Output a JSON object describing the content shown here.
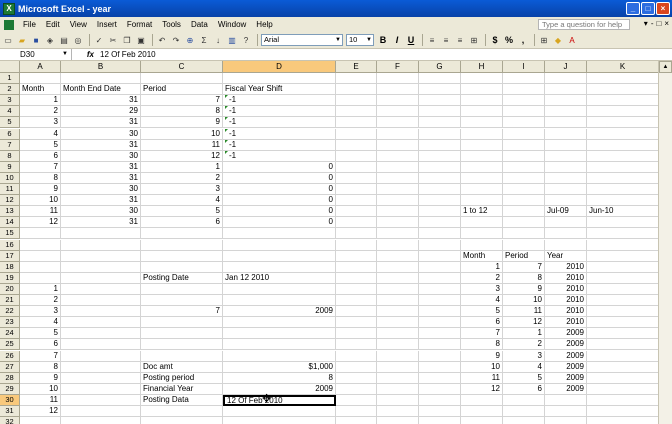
{
  "window": {
    "title": "Microsoft Excel - year",
    "minimize": "_",
    "maximize": "□",
    "close": "×"
  },
  "menu": {
    "items": [
      "File",
      "Edit",
      "View",
      "Insert",
      "Format",
      "Tools",
      "Data",
      "Window",
      "Help"
    ],
    "help_placeholder": "Type a question for help",
    "mdi_controls": [
      "▾",
      "-",
      "□",
      "×"
    ]
  },
  "toolbar": {
    "font_name": "Arial",
    "font_size": "10",
    "bold": "B",
    "italic": "I",
    "underline": "U",
    "currency": "$",
    "percent": "%",
    "comma": ","
  },
  "formula_bar": {
    "name_box": "D30",
    "fx": "fx",
    "formula": "12 Of Feb 2010"
  },
  "columns": [
    "A",
    "B",
    "C",
    "D",
    "E",
    "F",
    "G",
    "H",
    "I",
    "J",
    "K"
  ],
  "active_column": "D",
  "active_row": "30",
  "rows": [
    {
      "n": "1",
      "cells": {}
    },
    {
      "n": "2",
      "cells": {
        "A": "Month",
        "B": "Month End Date",
        "C": "Period",
        "D": "Fiscal Year Shift"
      }
    },
    {
      "n": "3",
      "cells": {
        "A": "1",
        "B": "31",
        "C": "7",
        "D": "-1"
      }
    },
    {
      "n": "4",
      "cells": {
        "A": "2",
        "B": "29",
        "C": "8",
        "D": "-1"
      }
    },
    {
      "n": "5",
      "cells": {
        "A": "3",
        "B": "31",
        "C": "9",
        "D": "-1"
      }
    },
    {
      "n": "6",
      "cells": {
        "A": "4",
        "B": "30",
        "C": "10",
        "D": "-1"
      }
    },
    {
      "n": "7",
      "cells": {
        "A": "5",
        "B": "31",
        "C": "11",
        "D": "-1"
      }
    },
    {
      "n": "8",
      "cells": {
        "A": "6",
        "B": "30",
        "C": "12",
        "D": "-1"
      }
    },
    {
      "n": "9",
      "cells": {
        "A": "7",
        "B": "31",
        "C": "1",
        "D": "0"
      }
    },
    {
      "n": "10",
      "cells": {
        "A": "8",
        "B": "31",
        "C": "2",
        "D": "0"
      }
    },
    {
      "n": "11",
      "cells": {
        "A": "9",
        "B": "30",
        "C": "3",
        "D": "0"
      }
    },
    {
      "n": "12",
      "cells": {
        "A": "10",
        "B": "31",
        "C": "4",
        "D": "0"
      }
    },
    {
      "n": "13",
      "cells": {
        "A": "11",
        "B": "30",
        "C": "5",
        "D": "0",
        "H": "1 to 12",
        "J": "Jul-09",
        "K": "Jun-10"
      }
    },
    {
      "n": "14",
      "cells": {
        "A": "12",
        "B": "31",
        "C": "6",
        "D": "0"
      }
    },
    {
      "n": "15",
      "cells": {}
    },
    {
      "n": "16",
      "cells": {}
    },
    {
      "n": "17",
      "cells": {
        "H": "Month",
        "I": "Period",
        "J": "Year"
      }
    },
    {
      "n": "18",
      "cells": {
        "H": "1",
        "I": "7",
        "J": "2010"
      }
    },
    {
      "n": "19",
      "cells": {
        "C": "Posting Date",
        "D": "Jan 12 2010",
        "H": "2",
        "I": "8",
        "J": "2010"
      }
    },
    {
      "n": "20",
      "cells": {
        "A": "1",
        "H": "3",
        "I": "9",
        "J": "2010"
      }
    },
    {
      "n": "21",
      "cells": {
        "A": "2",
        "H": "4",
        "I": "10",
        "J": "2010"
      }
    },
    {
      "n": "22",
      "cells": {
        "A": "3",
        "C": "7",
        "D": "2009",
        "H": "5",
        "I": "11",
        "J": "2010"
      }
    },
    {
      "n": "23",
      "cells": {
        "A": "4",
        "H": "6",
        "I": "12",
        "J": "2010"
      }
    },
    {
      "n": "24",
      "cells": {
        "A": "5",
        "H": "7",
        "I": "1",
        "J": "2009"
      }
    },
    {
      "n": "25",
      "cells": {
        "A": "6",
        "H": "8",
        "I": "2",
        "J": "2009"
      }
    },
    {
      "n": "26",
      "cells": {
        "A": "7",
        "H": "9",
        "I": "3",
        "J": "2009"
      }
    },
    {
      "n": "27",
      "cells": {
        "A": "8",
        "C": "Doc amt",
        "D": "$1,000",
        "H": "10",
        "I": "4",
        "J": "2009"
      }
    },
    {
      "n": "28",
      "cells": {
        "A": "9",
        "C": "Posting period",
        "D": "8",
        "H": "11",
        "I": "5",
        "J": "2009"
      }
    },
    {
      "n": "29",
      "cells": {
        "A": "10",
        "C": "Financial Year",
        "D": "2009",
        "H": "12",
        "I": "6",
        "J": "2009"
      }
    },
    {
      "n": "30",
      "cells": {
        "A": "11",
        "C": "Posting Data",
        "D": "12 Of Feb 2010"
      }
    },
    {
      "n": "31",
      "cells": {
        "A": "12"
      }
    },
    {
      "n": "32",
      "cells": {}
    }
  ],
  "colors": {
    "title_bar": "#0a5bd6",
    "chrome": "#ece9d8",
    "active_header": "#f9c97c",
    "comment_marker": "#2a8a2a"
  }
}
